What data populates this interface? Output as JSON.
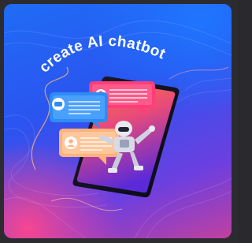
{
  "banner": {
    "headline": "create AI chatbot"
  },
  "colors": {
    "background_top": "#1f6cf5",
    "background_bottom": "#c1409f",
    "pink_glow": "#ff468c",
    "phone_screen_top": "#ff6a3c",
    "phone_screen_bottom": "#6c2ad8",
    "bubble_blue": "#2f8cf5",
    "bubble_pink": "#ff3e78",
    "bubble_peach": "#ffb27c"
  }
}
